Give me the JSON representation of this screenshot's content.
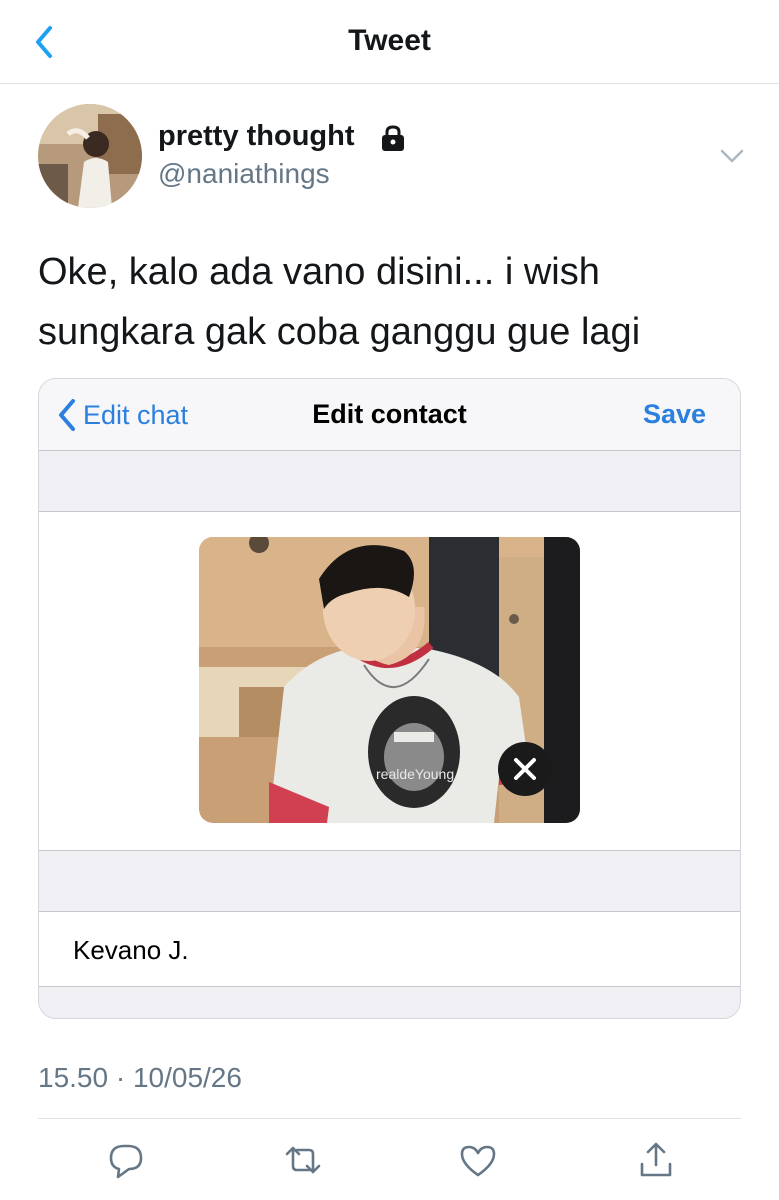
{
  "header": {
    "title": "Tweet"
  },
  "author": {
    "display_name": "pretty thought",
    "handle": "@naniathings"
  },
  "tweet": {
    "text": "Oke, kalo ada vano disini... i wish sungkara gak coba ganggu gue lagi",
    "timestamp": "15.50 · 10/05/26"
  },
  "embedded": {
    "back_label": "Edit chat",
    "title": "Edit contact",
    "save_label": "Save",
    "contact_name": "Kevano J.",
    "photo_watermark": "realdeYoung"
  },
  "colors": {
    "accent": "#1da1f2",
    "ios_blue": "#2b7fde",
    "secondary_text": "#657786"
  },
  "icons": [
    "back-chevron-icon",
    "lock-icon",
    "chevron-down-icon",
    "close-icon",
    "reply-icon",
    "retweet-icon",
    "like-icon",
    "share-icon"
  ]
}
